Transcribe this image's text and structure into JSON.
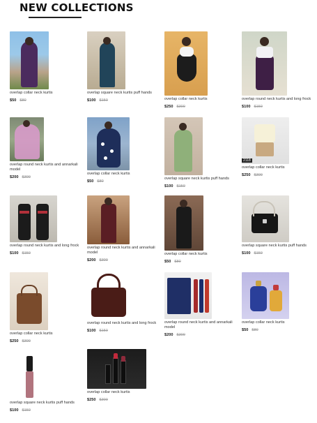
{
  "section": {
    "title": "NEW COLLECTIONS"
  },
  "products": [
    {
      "name": "overlap collar neck kurtis",
      "price": "$50",
      "old_price": "$80"
    },
    {
      "name": "overlap square neck kurtis puff hands",
      "price": "$100",
      "old_price": "$150"
    },
    {
      "name": "overlap collar neck kurtis",
      "price": "$250",
      "old_price": "$300"
    },
    {
      "name": "overlap round neck kurtis and long frock",
      "price": "$100",
      "old_price": "$150"
    },
    {
      "name": "overlap round neck kurtis and annarkali model",
      "price": "$200",
      "old_price": "$300"
    },
    {
      "name": "overlap collar neck kurtis",
      "price": "$50",
      "old_price": "$80"
    },
    {
      "name": "overlap square neck kurtis puff hands",
      "price": "$100",
      "old_price": "$150"
    },
    {
      "name": "overlap collar neck kurtis",
      "price": "$250",
      "old_price": "$300",
      "badge": "2118"
    },
    {
      "name": "overlap round neck kurtis and long frock",
      "price": "$100",
      "old_price": "$150"
    },
    {
      "name": "overlap round neck kurtis and annarkali model",
      "price": "$200",
      "old_price": "$300"
    },
    {
      "name": "overlap collar neck kurtis",
      "price": "$50",
      "old_price": "$80"
    },
    {
      "name": "overlap square neck kurtis puff hands",
      "price": "$100",
      "old_price": "$150"
    },
    {
      "name": "overlap collar neck kurtis",
      "price": "$250",
      "old_price": "$300"
    },
    {
      "name": "overlap round neck kurtis and long frock",
      "price": "$100",
      "old_price": "$150"
    },
    {
      "name": "overlap round neck kurtis and annarkali model",
      "price": "$200",
      "old_price": "$300"
    },
    {
      "name": "overlap collar neck kurtis",
      "price": "$50",
      "old_price": "$80"
    },
    {
      "name": "overlap square neck kurtis puff hands",
      "price": "$100",
      "old_price": "$150"
    },
    {
      "name": "overlap collar neck kurtis",
      "price": "$250",
      "old_price": "$300"
    }
  ]
}
